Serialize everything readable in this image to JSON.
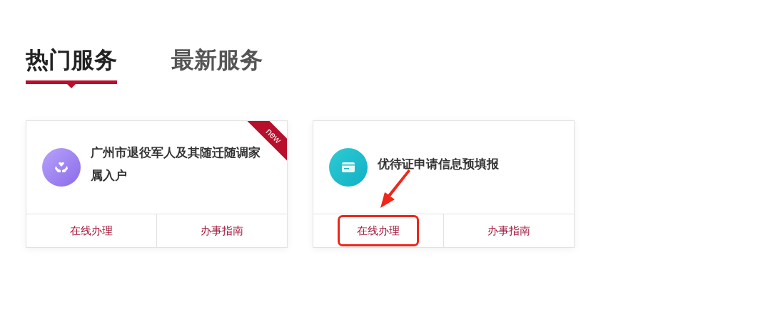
{
  "tabs": [
    {
      "label": "热门服务",
      "selected": true
    },
    {
      "label": "最新服务",
      "selected": false
    }
  ],
  "cards": [
    {
      "title": "广州市退役军人及其随迁随调家属入户",
      "kind": "hands",
      "is_new": true,
      "badge": "new",
      "actions": [
        {
          "label": "在线办理",
          "highlighted": false
        },
        {
          "label": "办事指南",
          "highlighted": false
        }
      ]
    },
    {
      "title": "优待证申请信息预填报",
      "kind": "card",
      "is_new": false,
      "actions": [
        {
          "label": "在线办理",
          "highlighted": true
        },
        {
          "label": "办事指南",
          "highlighted": false
        }
      ]
    }
  ]
}
